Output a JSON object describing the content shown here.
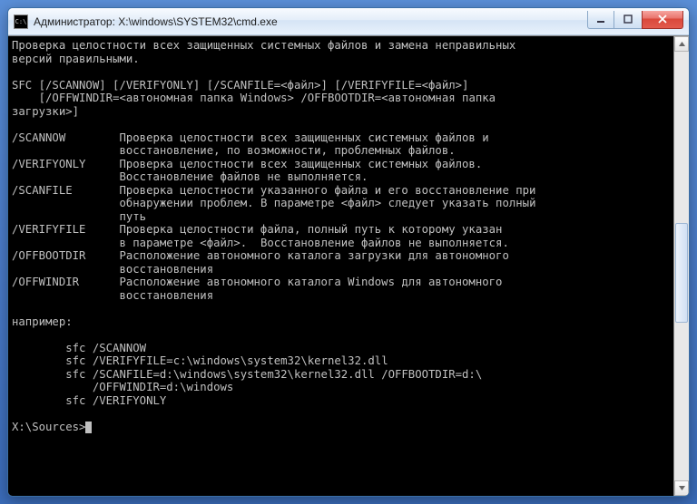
{
  "window": {
    "title": "Администратор: X:\\windows\\SYSTEM32\\cmd.exe",
    "icon_label": "C:\\"
  },
  "console": {
    "intro": "Проверка целостности всех защищенных системных файлов и замена неправильных\nверсий правильными.",
    "usage1": "SFC [/SCANNOW] [/VERIFYONLY] [/SCANFILE=<файл>] [/VERIFYFILE=<файл>]",
    "usage2": "    [/OFFWINDIR=<автономная папка Windows> /OFFBOOTDIR=<автономная папка\nзагрузки>]",
    "opts": [
      {
        "flag": "/SCANNOW",
        "desc": "Проверка целостности всех защищенных системных файлов и\nвосстановление, по возможности, проблемных файлов."
      },
      {
        "flag": "/VERIFYONLY",
        "desc": "Проверка целостности всех защищенных системных файлов.\nВосстановление файлов не выполняется."
      },
      {
        "flag": "/SCANFILE",
        "desc": "Проверка целостности указанного файла и его восстановление при\nобнаружении проблем. В параметре <файл> следует указать полный\nпуть"
      },
      {
        "flag": "/VERIFYFILE",
        "desc": "Проверка целостности файла, полный путь к которому указан\nв параметре <файл>.  Восстановление файлов не выполняется."
      },
      {
        "flag": "/OFFBOOTDIR",
        "desc": "Расположение автономного каталога загрузки для автономного\nвосстановления"
      },
      {
        "flag": "/OFFWINDIR",
        "desc": "Расположение автономного каталога Windows для автономного\nвосстановления"
      }
    ],
    "example_label": "например:",
    "examples": [
      "sfc /SCANNOW",
      "sfc /VERIFYFILE=c:\\windows\\system32\\kernel32.dll",
      "sfc /SCANFILE=d:\\windows\\system32\\kernel32.dll /OFFBOOTDIR=d:\\\n/OFFWINDIR=d:\\windows",
      "sfc /VERIFYONLY"
    ],
    "prompt": "X:\\Sources>"
  }
}
